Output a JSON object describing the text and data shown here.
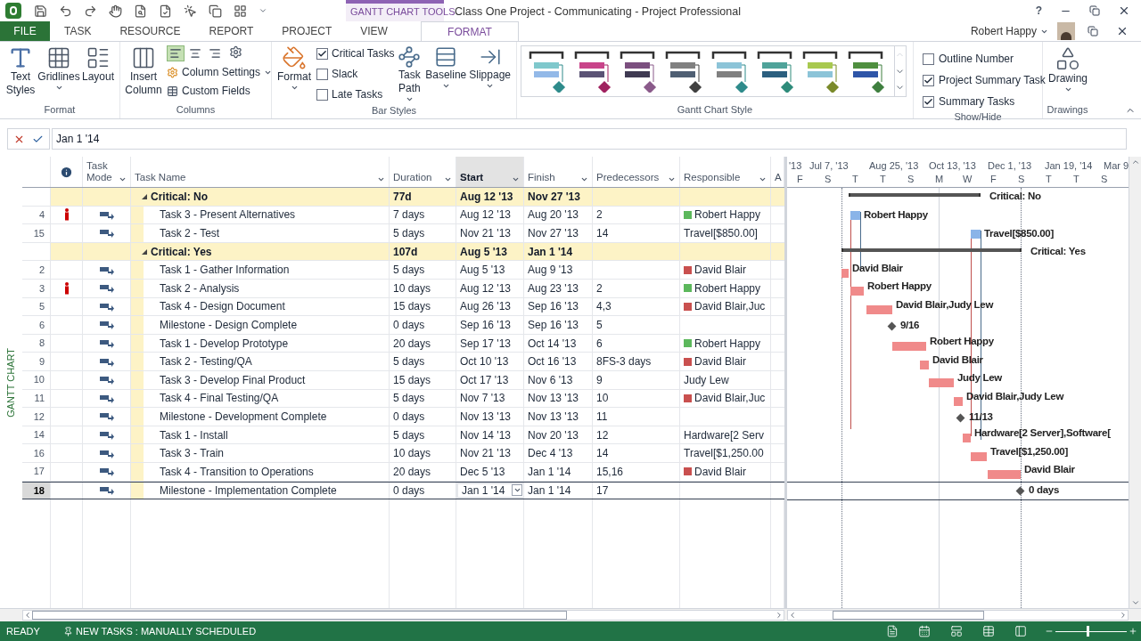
{
  "title_bar": {
    "context_label": "GANTT CHART TOOLS",
    "title": "Class One Project - Communicating - Project Professional",
    "help": "?",
    "user": "Robert Happy"
  },
  "tabs": [
    {
      "label": "FILE",
      "kind": "file",
      "selected": false
    },
    {
      "label": "TASK",
      "kind": "normal",
      "selected": false
    },
    {
      "label": "RESOURCE",
      "kind": "normal",
      "selected": false
    },
    {
      "label": "REPORT",
      "kind": "normal",
      "selected": false
    },
    {
      "label": "PROJECT",
      "kind": "normal",
      "selected": false
    },
    {
      "label": "VIEW",
      "kind": "normal",
      "selected": false
    },
    {
      "label": "FORMAT",
      "kind": "context",
      "selected": true
    }
  ],
  "ribbon": {
    "format_group": {
      "label": "Format",
      "buttons": [
        "Text Styles",
        "Gridlines",
        "Layout"
      ]
    },
    "columns_group": {
      "label": "Columns",
      "insert": "Insert Column",
      "align": [
        {
          "selected": true
        },
        {
          "selected": false
        },
        {
          "selected": false
        }
      ],
      "column_settings": "Column Settings",
      "custom_fields": "Custom Fields"
    },
    "bar_styles_group": {
      "label": "Bar Styles",
      "format": "Format",
      "checkboxes": [
        {
          "label": "Critical Tasks",
          "checked": true
        },
        {
          "label": "Slack",
          "checked": false
        },
        {
          "label": "Late Tasks",
          "checked": false
        }
      ],
      "buttons": [
        "Task Path",
        "Baseline",
        "Slippage"
      ]
    },
    "gantt_style_group": {
      "label": "Gantt Chart Style",
      "styles": [
        {
          "task_bar": {
            "color": "#7fc8cc"
          },
          "baseline_bar": {
            "color": "#93b9e8"
          },
          "milestone": {
            "color": "#2e8b8b"
          }
        },
        {
          "task_bar": {
            "color": "#c9448a"
          },
          "baseline_bar": {
            "color": "#5b5375"
          },
          "milestone": {
            "color": "#a0215f"
          }
        },
        {
          "task_bar": {
            "color": "#7b4f7f"
          },
          "baseline_bar": {
            "color": "#3f3a52"
          },
          "milestone": {
            "color": "#8a5a8a"
          }
        },
        {
          "task_bar": {
            "color": "#808080"
          },
          "baseline_bar": {
            "color": "#4f5f73"
          },
          "milestone": {
            "color": "#404040"
          }
        },
        {
          "task_bar": {
            "color": "#8cc4d8"
          },
          "baseline_bar": {
            "color": "#808080"
          },
          "milestone": {
            "color": "#2e8b8b"
          }
        },
        {
          "task_bar": {
            "color": "#4fa39a"
          },
          "baseline_bar": {
            "color": "#2b5f7f"
          },
          "milestone": {
            "color": "#2e8b7a"
          }
        },
        {
          "task_bar": {
            "color": "#a8c94f"
          },
          "baseline_bar": {
            "color": "#8cc4d8"
          },
          "milestone": {
            "color": "#7a8a2a"
          }
        },
        {
          "task_bar": {
            "color": "#4f8f3f"
          },
          "baseline_bar": {
            "color": "#2e55a8"
          },
          "milestone": {
            "color": "#3f7f3f"
          }
        }
      ]
    },
    "show_hide_group": {
      "label": "Show/Hide",
      "checkboxes": [
        {
          "label": "Outline Number",
          "checked": false
        },
        {
          "label": "Project Summary Task",
          "checked": true
        },
        {
          "label": "Summary Tasks",
          "checked": true
        }
      ]
    },
    "drawings_group": {
      "label": "Drawings",
      "button": "Drawing"
    }
  },
  "entry_bar": {
    "value": "Jan 1 '14"
  },
  "view_label": "GANTT CHART",
  "table": {
    "columns": [
      {
        "label": "Task Mode",
        "selected": false
      },
      {
        "label": "Task Name",
        "selected": false
      },
      {
        "label": "Duration",
        "selected": false
      },
      {
        "label": "Start",
        "selected": true
      },
      {
        "label": "Finish",
        "selected": false
      },
      {
        "label": "Predecessors",
        "selected": false
      },
      {
        "label": "Responsible",
        "selected": false
      },
      {
        "label": "A",
        "selected": false
      }
    ],
    "rows": [
      {
        "kind": "summary",
        "selected": false,
        "name": "Critical: No",
        "duration": "77d",
        "start": "Aug 12 '13",
        "finish": "Nov 27 '13"
      },
      {
        "kind": "task",
        "selected": false,
        "id": "4",
        "indicator": true,
        "name": "Task 3 - Present Alternatives",
        "duration": "7 days",
        "start": "Aug 12 '13",
        "finish": "Aug 20 '13",
        "predecessors": "2",
        "responsible": "Robert Happy",
        "color": "#5cb85c"
      },
      {
        "kind": "task",
        "selected": false,
        "id": "15",
        "indicator": false,
        "name": "Task 2 - Test",
        "duration": "5 days",
        "start": "Nov 21 '13",
        "finish": "Nov 27 '13",
        "predecessors": "14",
        "responsible": "Travel[$850.00]"
      },
      {
        "kind": "summary",
        "selected": false,
        "name": "Critical: Yes",
        "duration": "107d",
        "start": "Aug 5 '13",
        "finish": "Jan 1 '14"
      },
      {
        "kind": "task",
        "selected": false,
        "id": "2",
        "indicator": false,
        "name": "Task 1 - Gather Information",
        "duration": "5 days",
        "start": "Aug 5 '13",
        "finish": "Aug 9 '13",
        "responsible": "David Blair",
        "color": "#c9504f"
      },
      {
        "kind": "task",
        "selected": false,
        "id": "3",
        "indicator": true,
        "name": "Task 2 - Analysis",
        "duration": "10 days",
        "start": "Aug 12 '13",
        "finish": "Aug 23 '13",
        "predecessors": "2",
        "responsible": "Robert Happy",
        "color": "#5cb85c"
      },
      {
        "kind": "task",
        "selected": false,
        "id": "5",
        "indicator": false,
        "name": "Task 4 - Design Document",
        "duration": "15 days",
        "start": "Aug 26 '13",
        "finish": "Sep 16 '13",
        "predecessors": "4,3",
        "responsible": "David Blair,Juc",
        "color": "#c9504f"
      },
      {
        "kind": "task",
        "selected": false,
        "id": "6",
        "indicator": false,
        "name": "Milestone - Design Complete",
        "duration": "0 days",
        "start": "Sep 16 '13",
        "finish": "Sep 16 '13",
        "predecessors": "5"
      },
      {
        "kind": "task",
        "selected": false,
        "id": "8",
        "indicator": false,
        "name": "Task 1 - Develop Prototype",
        "duration": "20 days",
        "start": "Sep 17 '13",
        "finish": "Oct 14 '13",
        "predecessors": "6",
        "responsible": "Robert Happy",
        "color": "#5cb85c"
      },
      {
        "kind": "task",
        "selected": false,
        "id": "9",
        "indicator": false,
        "name": "Task 2 - Testing/QA",
        "duration": "5 days",
        "start": "Oct 10 '13",
        "finish": "Oct 16 '13",
        "predecessors": "8FS-3 days",
        "responsible": "David Blair",
        "color": "#c9504f"
      },
      {
        "kind": "task",
        "selected": false,
        "id": "10",
        "indicator": false,
        "name": "Task 3 - Develop Final Product",
        "duration": "15 days",
        "start": "Oct 17 '13",
        "finish": "Nov 6 '13",
        "predecessors": "9",
        "responsible": "Judy Lew"
      },
      {
        "kind": "task",
        "selected": false,
        "id": "11",
        "indicator": false,
        "name": "Task 4 - Final Testing/QA",
        "duration": "5 days",
        "start": "Nov 7 '13",
        "finish": "Nov 13 '13",
        "predecessors": "10",
        "responsible": "David Blair,Juc",
        "color": "#c9504f"
      },
      {
        "kind": "task",
        "selected": false,
        "id": "12",
        "indicator": false,
        "name": "Milestone - Development Complete",
        "duration": "0 days",
        "start": "Nov 13 '13",
        "finish": "Nov 13 '13",
        "predecessors": "11"
      },
      {
        "kind": "task",
        "selected": false,
        "id": "14",
        "indicator": false,
        "name": "Task 1 - Install",
        "duration": "5 days",
        "start": "Nov 14 '13",
        "finish": "Nov 20 '13",
        "predecessors": "12",
        "responsible": "Hardware[2 Serv"
      },
      {
        "kind": "task",
        "selected": false,
        "id": "16",
        "indicator": false,
        "name": "Task 3 - Train",
        "duration": "10 days",
        "start": "Nov 21 '13",
        "finish": "Dec 4 '13",
        "predecessors": "14",
        "responsible": "Travel[$1,250.00"
      },
      {
        "kind": "task",
        "selected": false,
        "id": "17",
        "indicator": false,
        "name": "Task 4 - Transition to Operations",
        "duration": "20 days",
        "start": "Dec 5 '13",
        "finish": "Jan 1 '14",
        "predecessors": "15,16",
        "responsible": "David Blair",
        "color": "#c9504f"
      },
      {
        "kind": "task",
        "selected": true,
        "id": "18",
        "indicator": false,
        "name": "Milestone - Implementation Complete",
        "duration": "0 days",
        "start": "Jan 1 '14",
        "finish": "Jan 1 '14",
        "predecessors": "17"
      }
    ]
  },
  "gantt": {
    "timescale_top": [
      "'13",
      "Jul 7, '13",
      "Aug 25, '13",
      "Oct 13, '13",
      "Dec 1, '13",
      "Jan 19, '14",
      "Mar 9"
    ],
    "timescale_bottom": [
      "F",
      "S",
      "T",
      "T",
      "S",
      "M",
      "W",
      "F",
      "S",
      "T",
      "T",
      "S"
    ],
    "bars": [
      {
        "kind": "summary",
        "label": "Critical: No"
      },
      {
        "kind": "resource",
        "label": "Robert Happy"
      },
      {
        "kind": "resource",
        "label": "Travel[$850.00]"
      },
      {
        "kind": "summary",
        "label": "Critical: Yes"
      },
      {
        "kind": "critical",
        "label": "David Blair"
      },
      {
        "kind": "critical",
        "label": "Robert Happy"
      },
      {
        "kind": "critical",
        "label": "David Blair,Judy Lew"
      },
      {
        "kind": "milestone",
        "label": "9/16"
      },
      {
        "kind": "critical",
        "label": "Robert Happy"
      },
      {
        "kind": "critical",
        "label": "David Blair"
      },
      {
        "kind": "critical",
        "label": "Judy Lew"
      },
      {
        "kind": "critical",
        "label": "David Blair,Judy Lew"
      },
      {
        "kind": "milestone",
        "label": "11/13"
      },
      {
        "kind": "critical",
        "label": "Hardware[2 Server],Software["
      },
      {
        "kind": "critical",
        "label": "Travel[$1,250.00]"
      },
      {
        "kind": "critical",
        "label": "David Blair"
      },
      {
        "kind": "milestone",
        "label": "0 days"
      }
    ]
  },
  "status_bar": {
    "ready": "READY",
    "new_tasks": "NEW TASKS : MANUALLY SCHEDULED",
    "zoom": {
      "level": 0.45
    }
  }
}
